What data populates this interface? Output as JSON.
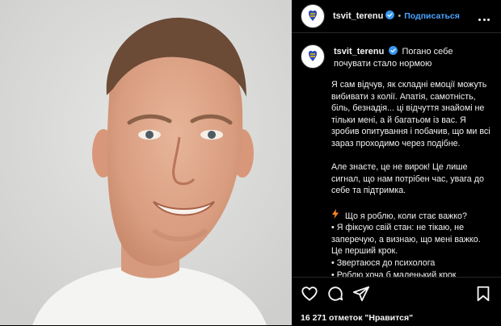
{
  "post": {
    "username": "tsvit_terenu",
    "separator": "•",
    "follow_label": "Подписаться",
    "caption_title": "Погано себе почувати стало нормою",
    "caption_paragraphs": [
      "Я сам відчув, як складні емоції можуть вибивати з колії. Апатія, самотність, біль, безнадія... ці відчуття знайомі не тільки мені, а й багатьом із вас. Я зробив опитування і побачив, що ми всі зараз проходимо через подібне.",
      "Але знаєте, це не вирок! Це лише сигнал, що нам потрібен час, увага до себе та підтримка."
    ],
    "list_header": "Що я роблю, коли стає важко?",
    "list_items": [
      "• Я фіксую свій стан: не тікаю, не заперечую, а визнаю, що мені важко. Це перший крок.",
      "• Звертаюся до психолога",
      "• Роблю хоча б маленький крок"
    ],
    "likes_text": "16 271 отметок \"Нравится\""
  },
  "colors": {
    "accent": "#4aa3ff",
    "verified": "#3897f0",
    "bolt": "#ff8a1f"
  },
  "icons": {
    "more": "more-options-icon",
    "like": "heart-icon",
    "comment": "comment-icon",
    "share": "share-icon",
    "save": "bookmark-icon"
  }
}
